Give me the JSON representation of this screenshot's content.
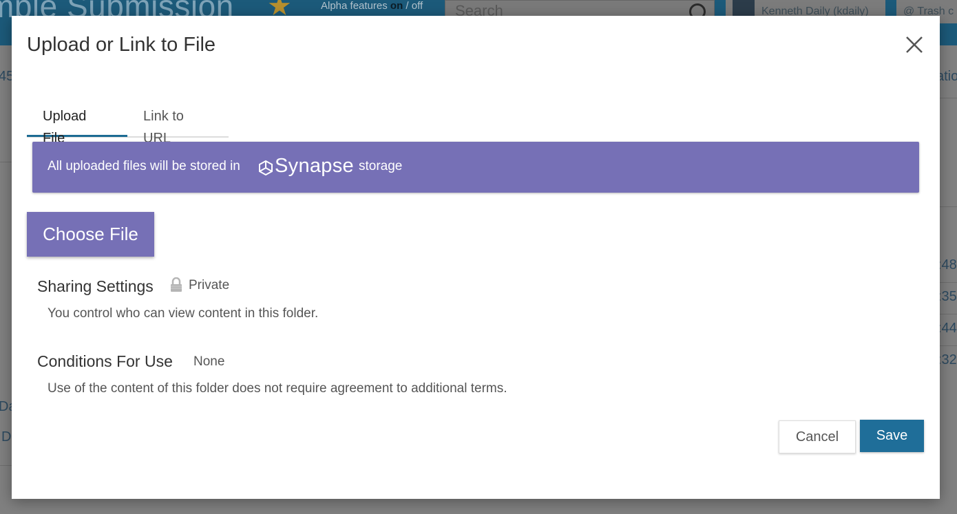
{
  "background": {
    "title": "mple Submission",
    "alpha_prefix": "Alpha features ",
    "alpha_on": "on",
    "alpha_suffix": " / off",
    "search_placeholder": "Search",
    "user_name": "Kenneth Daily (kdaily)",
    "trash_label": "@ Trash c",
    "side_left_1": "45",
    "side_right_1": "atio",
    "row_times": [
      ":48",
      ":35",
      ":44",
      ":32"
    ],
    "left_links": [
      "Da",
      "D"
    ]
  },
  "modal": {
    "title": "Upload or Link to File",
    "tabs": [
      {
        "label": "Upload File",
        "active": true
      },
      {
        "label": "Link to URL",
        "active": false
      }
    ],
    "banner": {
      "text_before": "All uploaded files will be stored in",
      "logo_word": "Synapse",
      "text_after": "storage"
    },
    "choose_file_label": "Choose File",
    "sharing": {
      "label": "Sharing Settings",
      "value": "Private",
      "description": "You control who can view content in this folder."
    },
    "conditions": {
      "label": "Conditions For Use",
      "value": "None",
      "description": "Use of the content of this folder does not require agreement to additional terms."
    },
    "cancel_label": "Cancel",
    "save_label": "Save"
  },
  "colors": {
    "accent_purple": "#7670b6",
    "primary_blue": "#1f6e99",
    "header_blue": "#1c5a7a"
  }
}
